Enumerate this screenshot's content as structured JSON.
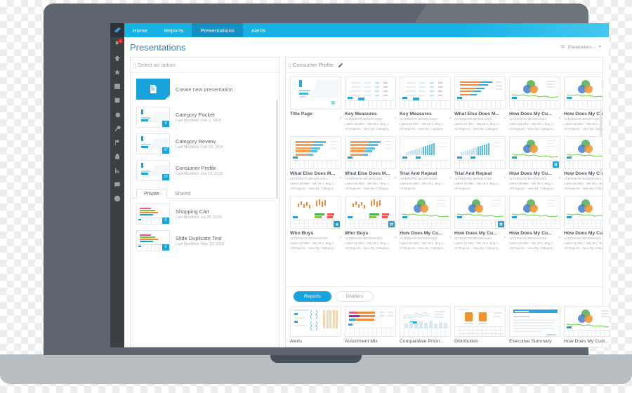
{
  "app": {
    "topnav": [
      {
        "label": "Home",
        "active": false
      },
      {
        "label": "Reports",
        "active": false
      },
      {
        "label": "Presentations",
        "active": true
      },
      {
        "label": "Alerts",
        "active": false
      }
    ],
    "page_title": "Presentations",
    "parameters_label": "Parameters...",
    "accent_color": "#18a3dd",
    "topbar_color": "#16b2e5"
  },
  "rail": {
    "logo": "droplet-logo-icon",
    "badge_count": "1",
    "items": [
      {
        "icon": "pin-alert-icon",
        "badge": "1"
      },
      {
        "icon": "home-icon",
        "badge": ""
      },
      {
        "icon": "star-icon",
        "badge": ""
      },
      {
        "icon": "calendar-icon",
        "badge": ""
      },
      {
        "icon": "database-icon",
        "badge": ""
      },
      {
        "icon": "gear-icon",
        "badge": ""
      },
      {
        "icon": "wrench-icon",
        "badge": ""
      },
      {
        "icon": "flag-icon",
        "badge": ""
      },
      {
        "icon": "lock-icon",
        "badge": ""
      },
      {
        "icon": "chart-icon",
        "badge": ""
      },
      {
        "icon": "comment-icon",
        "badge": ""
      },
      {
        "icon": "help-icon",
        "badge": ""
      }
    ]
  },
  "left_panel": {
    "select_placeholder": "Select an option",
    "create_label": "Create new presentation",
    "presentations": [
      {
        "name": "Category Packet",
        "meta": "Last Modified: Feb 1, 2016",
        "badge": "9"
      },
      {
        "name": "Category Review",
        "meta": "Last Modified: Feb 24, 2016",
        "badge": "47"
      },
      {
        "name": "Consumer Profile",
        "meta": "Last Modified: Jun 13, 2016",
        "badge": "22"
      }
    ],
    "tabs": [
      {
        "label": "Private",
        "active": true
      },
      {
        "label": "Shared",
        "active": false
      }
    ],
    "shared_items": [
      {
        "name": "Shopping Cart",
        "meta": "Last Modified: Jul 28, 2016",
        "badge": "9"
      },
      {
        "name": "Slide Duplicate Test",
        "meta": "Last Modified: May 19, 2016",
        "badge": "6"
      }
    ]
  },
  "right_panel": {
    "title": "Consumer Profile",
    "edit_icon": "pencil-icon",
    "slides": [
      {
        "title": "Title Page",
        "sub1": "",
        "sub2": "",
        "sub3": "",
        "thumb": "title",
        "badge": ""
      },
      {
        "title": "Key Measures",
        "sub1": "ALTERNATE BEVERAGES",
        "sub2": "Latest 26 Wks - Wk 28-1, Beg J...",
        "sub3": "All Regions - View By: Category",
        "thumb": "table",
        "badge": ""
      },
      {
        "title": "Key Measures",
        "sub1": "ALTERNATE BEVERAGES",
        "sub2": "Latest 26 Wks - Wk 28-1, Beg J...",
        "sub3": "All Regions - View By: Category",
        "thumb": "table",
        "badge": ""
      },
      {
        "title": "What Else Does M...",
        "sub1": "ALTERNATE BEVERAGES",
        "sub2": "Latest 26 Wks - Wk 28-1, Beg J...",
        "sub3": "All Regions - View By: Category",
        "thumb": "hbar",
        "badge": ""
      },
      {
        "title": "How Does My Cu...",
        "sub1": "ALTERNATE BEVERAGES",
        "sub2": "Latest 26 Wks - Wk 28-1, Beg J...",
        "sub3": "All Regions - View By: Category...",
        "thumb": "venn",
        "badge": ""
      },
      {
        "title": "How Does My Cu...",
        "sub1": "ALTERNATE BEVERAGES",
        "sub2": "Latest 26 Wks - Wk 28-1, Beg J...",
        "sub3": "All Regions - View By: Category...",
        "thumb": "venn",
        "badge": ""
      },
      {
        "title": "What Else Does M...",
        "sub1": "ALTERNATE BEVERAGES",
        "sub2": "Latest 26 Wks - Wk 28-1, Beg J...",
        "sub3": "All Regions - View By: Category",
        "thumb": "hbar2",
        "badge": ""
      },
      {
        "title": "What Else Does M...",
        "sub1": "ALTERNATE BEVERAGES",
        "sub2": "Latest 26 Wks - Wk 28-1, Beg J...",
        "sub3": "All Regions - View By: Category",
        "thumb": "hbar2",
        "badge": ""
      },
      {
        "title": "Trial And Repeat",
        "sub1": "ALTERNATE BEVERAGES",
        "sub2": "Latest 26 Wks - Wk 28-1, Beg J...",
        "sub3": "All Regions",
        "thumb": "vbar",
        "badge": ""
      },
      {
        "title": "Trial And Repeat",
        "sub1": "ALTERNATE BEVERAGES",
        "sub2": "Latest 26 Wks - Wk 28-1, Beg J...",
        "sub3": "All Regions",
        "thumb": "vbar",
        "badge": ""
      },
      {
        "title": "How Does My Cu...",
        "sub1": "ALTERNATE BEVERAGES",
        "sub2": "Latest 26 Wks - Wk 28-1, Beg J...",
        "sub3": "All Regions - View By: Category...",
        "thumb": "venn",
        "badge": "grid-badge-icon"
      },
      {
        "title": "How Does My Cu...",
        "sub1": "ALTERNATE BEVERAGES",
        "sub2": "Latest 26 Wks - Wk 28-1, Beg J...",
        "sub3": "All Regions - View By: Category...",
        "thumb": "venn",
        "badge": "grid-badge-icon"
      },
      {
        "title": "Who Buys",
        "sub1": "ALTERNATE BEVERAGES",
        "sub2": "Latest 26 Wks - Wk 28-1, Beg J...",
        "sub3": "All Regions - View By: Category...",
        "thumb": "scatter",
        "badge": "gear-badge-icon"
      },
      {
        "title": "Who Buys",
        "sub1": "ALTERNATE BEVERAGES",
        "sub2": "Latest 26 Wks - Wk 28-1, Beg J...",
        "sub3": "All Regions - View By: Category...",
        "thumb": "scatter",
        "badge": "grid-badge-icon"
      },
      {
        "title": "How Does My Cu...",
        "sub1": "ALTERNATE BEVERAGES",
        "sub2": "Latest 26 Wks - Wk 28-1, Beg J...",
        "sub3": "All Regions - View By: Category...",
        "thumb": "venn",
        "badge": ""
      },
      {
        "title": "How Does My Cu...",
        "sub1": "ALTERNATE BEVERAGES",
        "sub2": "Latest 26 Wks - Wk 28-1, Beg J...",
        "sub3": "All Regions - View By: Category...",
        "thumb": "venn",
        "badge": "grid-badge-icon"
      },
      {
        "title": "How Does My Cu...",
        "sub1": "ALTERNATE BEVERAGES",
        "sub2": "Latest 26 Wks - Wk 28-1, Beg J...",
        "sub3": "All Regions - View By: Category...",
        "thumb": "venn",
        "badge": ""
      },
      {
        "title": "How Does My Cu...",
        "sub1": "ALTERNATE BEVERAGES",
        "sub2": "Latest 26 Wks - Wk 28-1, Beg J...",
        "sub3": "All Regions - View By: Category...",
        "thumb": "venn",
        "badge": "grid-badge-icon"
      }
    ],
    "bottom_tabs": [
      {
        "label": "Reports",
        "active": true
      },
      {
        "label": "Dividers",
        "active": false
      }
    ],
    "reports": [
      {
        "title": "Alerts",
        "thumb": "alerts"
      },
      {
        "title": "Assortment Mix",
        "thumb": "assortment"
      },
      {
        "title": "Comparative Pricin...",
        "thumb": "comparative"
      },
      {
        "title": "Distribution",
        "thumb": "distribution"
      },
      {
        "title": "Executive Summary",
        "thumb": "execsummary"
      },
      {
        "title": "How Does My Cust...",
        "thumb": "venn"
      }
    ]
  }
}
